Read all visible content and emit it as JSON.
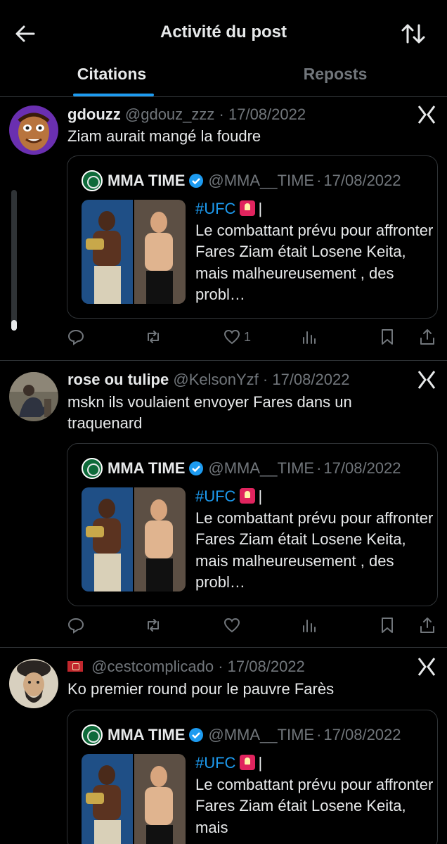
{
  "header": {
    "title": "Activité du post",
    "back_icon": "back-arrow-icon",
    "sort_icon": "sort-arrows-icon"
  },
  "tabs": [
    {
      "label": "Citations",
      "active": true
    },
    {
      "label": "Reposts",
      "active": false
    }
  ],
  "colors": {
    "accent": "#1d9bf0",
    "muted": "#71767b",
    "text": "#e7e9ea",
    "border": "#2f3336",
    "background": "#000000"
  },
  "quoted_post": {
    "name": "MMA TIME",
    "handle": "@MMA__TIME",
    "date": "17/08/2022",
    "hashtag": "#UFC",
    "after_emoji": "|",
    "text": "Le combattant prévu pour affronter Fares Ziam était Losene Keita, mais malheureusement , des probl…",
    "text_cut": "Le combattant prévu pour affronter Fares Ziam était Losene Keita, mais"
  },
  "posts": [
    {
      "name": "gdouzz",
      "handle": "@gdouz_zzz",
      "sep": "·",
      "date": "17/08/2022",
      "text": "Ziam aurait mangé la foudre",
      "likes": "1"
    },
    {
      "name": "rose ou tulipe",
      "handle": "@KelsonYzf",
      "sep": "·",
      "date": "17/08/2022",
      "text": "mskn ils voulaient envoyer Fares dans un traquenard",
      "likes": ""
    },
    {
      "name": "",
      "handle": "@cestcomplicado",
      "sep": "·",
      "date": "17/08/2022",
      "text": "Ko premier round pour le pauvre Farès",
      "likes": ""
    }
  ]
}
